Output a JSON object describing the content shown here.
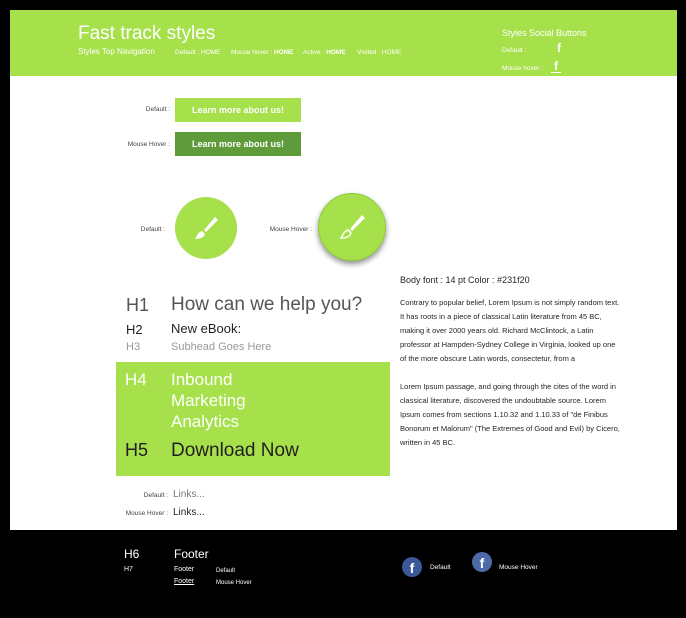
{
  "header": {
    "title": "Fast track styles",
    "subtitle": "Styles Top Navigation",
    "nav": {
      "default_label": "Default : ",
      "default_value": "HOME",
      "hover_label": "Mouse hover : ",
      "hover_value": "HOME",
      "active_label": "Active : ",
      "active_value": "HOME",
      "visited_label": "Visited : ",
      "visited_value": "HOME"
    },
    "social": {
      "title": "Styles Social Buttons",
      "default_label": "Default :",
      "hover_label": "Mouse hover :",
      "icon": "facebook-icon"
    }
  },
  "buttons": {
    "default_label": "Default :",
    "hover_label": "Mouse Hover :",
    "button_text": "Learn more about us!",
    "default_color": "#a6e04a",
    "hover_color": "#5f9b3b"
  },
  "circles": {
    "default_label": "Default :",
    "hover_label": "Mouse Hover :",
    "icon": "paintbrush-icon"
  },
  "typography": {
    "h1_tag": "H1",
    "h1_text": "How can we help you?",
    "h2_tag": "H2",
    "h2_text": "New eBook:",
    "h3_tag": "H3",
    "h3_text": "Subhead Goes Here",
    "h4_tag": "H4",
    "h4_line1": "Inbound",
    "h4_line2": "Marketing",
    "h4_line3": "Analytics",
    "h5_tag": "H5",
    "h5_text": "Download Now",
    "links_default_label": "Default :",
    "links_hover_label": "Mouse Hover :",
    "links_text": "Links..."
  },
  "body": {
    "font_label": "Body font : 14 pt  Color : #231f20",
    "para1": "Contrary to popular belief, Lorem Ipsum is not simply random text. It has roots in a piece of classical Latin literature from 45 BC, making it over 2000 years old. Richard McClintock, a Latin professor at Hampden-Sydney College in Virginia, looked up one of the more obscure Latin words, consectetur, from a",
    "para2": "Lorem Ipsum passage, and going through the cites of the word in classical literature, discovered the undoubtable source. Lorem Ipsum comes from sections 1.10.32 and 1.10.33 of \"de Finibus Bonorum et Malorum\"  (The Extremes of Good and Evil) by Cicero, written in 45 BC."
  },
  "footer": {
    "h6_tag": "H6",
    "h6_text": "Footer",
    "h7_tag": "H7",
    "footer_default": "Footer",
    "default_label": "Default",
    "footer_hover": "Footer",
    "hover_label": "Mouse Hover",
    "fb_default_label": "Default",
    "fb_hover_label": "Mouse Hover"
  },
  "colors": {
    "accent": "#a6e04a",
    "accent_dark": "#5f9b3b",
    "facebook": "#3b5998",
    "text": "#231f20"
  }
}
